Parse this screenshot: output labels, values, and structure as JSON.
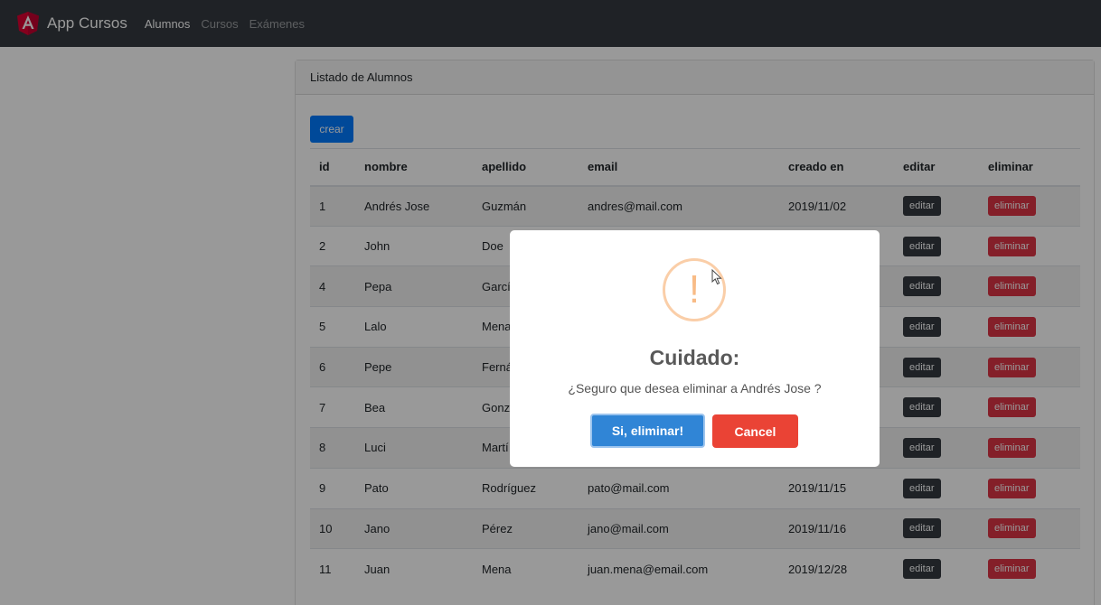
{
  "navbar": {
    "brand": "App Cursos",
    "links": [
      {
        "label": "Alumnos"
      },
      {
        "label": "Cursos"
      },
      {
        "label": "Exámenes"
      }
    ]
  },
  "card": {
    "header": "Listado de Alumnos",
    "create_label": "crear"
  },
  "table": {
    "headers": [
      "id",
      "nombre",
      "apellido",
      "email",
      "creado en",
      "editar",
      "eliminar"
    ],
    "edit_label": "editar",
    "delete_label": "eliminar",
    "rows": [
      {
        "id": "1",
        "nombre": "Andrés Jose",
        "apellido": "Guzmán",
        "email": "andres@mail.com",
        "creado": "2019/11/02"
      },
      {
        "id": "2",
        "nombre": "John",
        "apellido": "Doe",
        "email": "",
        "creado": ""
      },
      {
        "id": "4",
        "nombre": "Pepa",
        "apellido": "Garcí",
        "email": "",
        "creado": ""
      },
      {
        "id": "5",
        "nombre": "Lalo",
        "apellido": "Mena",
        "email": "",
        "creado": ""
      },
      {
        "id": "6",
        "nombre": "Pepe",
        "apellido": "Ferná",
        "email": "",
        "creado": ""
      },
      {
        "id": "7",
        "nombre": "Bea",
        "apellido": "Gonz",
        "email": "",
        "creado": ""
      },
      {
        "id": "8",
        "nombre": "Luci",
        "apellido": "Martí",
        "email": "",
        "creado": ""
      },
      {
        "id": "9",
        "nombre": "Pato",
        "apellido": "Rodríguez",
        "email": "pato@mail.com",
        "creado": "2019/11/15"
      },
      {
        "id": "10",
        "nombre": "Jano",
        "apellido": "Pérez",
        "email": "jano@mail.com",
        "creado": "2019/11/16"
      },
      {
        "id": "11",
        "nombre": "Juan",
        "apellido": "Mena",
        "email": "juan.mena@email.com",
        "creado": "2019/12/28"
      }
    ]
  },
  "modal": {
    "icon": "!",
    "title": "Cuidado:",
    "text": "¿Seguro que desea eliminar a Andrés Jose ?",
    "confirm_label": "Si, eliminar!",
    "cancel_label": "Cancel"
  }
}
